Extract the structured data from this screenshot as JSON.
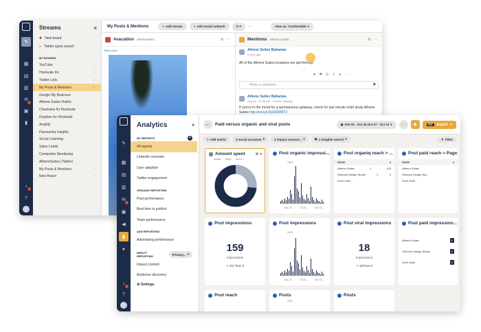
{
  "streams": {
    "title": "Streams",
    "quick": [
      "New board",
      "Twitter quick search"
    ],
    "section": "MY BOARDS",
    "boards": [
      "YouTube",
      "Hootsuite Inc",
      "Twitter Lists",
      "My Posts & Mentions",
      "Google My Business",
      "Athene Suites Hotels",
      "Cloudview for Hootsuite",
      "Dropbox for Hootsuite",
      "Amplify",
      "Panoramiq Insights",
      "Social Listening",
      "Sales Leads",
      "Competitor Monitoring",
      "AtheneSuites (Twitter)",
      "My Posts & Mentions",
      "New Board"
    ],
    "toolbar": {
      "title": "My Posts & Mentions",
      "add_stream": "Add stream",
      "add_network": "Add social network",
      "view": "View as: Comfortable"
    },
    "col1": {
      "title": "#vacation",
      "sub": "athenesuites"
    },
    "col1_img_note": "Read more",
    "col2": {
      "title": "Mentions",
      "sub": "Athene Suites"
    },
    "tweet1": {
      "name": "Athene Suites Bahamas",
      "meta": "6 mins ago",
      "text": "All of the Athene Suites locations are pet friendly!"
    },
    "comment_placeholder": "Write a comment...",
    "tweet2": {
      "name": "Athene Suites Bahamas",
      "meta": "Aug 26 · 10:35 AM · Custom Visibility",
      "text": "If you're in the mood for a spontaneous getaway, check for last minute hotel deals Athene Suites",
      "link": "http://ow.ly/r2b2S0RMT3"
    }
  },
  "analytics": {
    "title": "Analytics",
    "sec1": "MY REPORTS",
    "reports": [
      "All reports",
      "LinkedIn overview",
      "User adoption",
      "Twitter engagement"
    ],
    "sec2": "ORGANIC REPORTING",
    "organic": [
      "Post performance",
      "Best time to publish",
      "Team performance"
    ],
    "sec3": "ADS REPORTING",
    "ads": [
      "Advertising performance"
    ],
    "sec4": "IMPACT REPORTING",
    "primary": "Primary...",
    "impact": [
      "Impact content",
      "Audience discovery"
    ],
    "settings": "Settings",
    "report_title": "Paid versus organic and viral posts",
    "date_range": "Feb 01 - Oct 20  Oct 07 - Oct 13",
    "export": "Export",
    "filters": [
      "Add metric",
      "3 social accounts",
      "3 impact connect...",
      "1 insights search",
      "Filter"
    ],
    "cards": {
      "amount_spent": "Amount spent",
      "legend": [
        "SHARE",
        "VIDEO",
        "PHOTO"
      ],
      "organic_imp": "Post organic impressi...",
      "organic_reach": "Post organiq reach > ...",
      "paid_reach": "Post paid reach > Page",
      "post_imp_1": "Post impressions",
      "post_imp_2": "Post impressions",
      "viral": "Post viral impressions",
      "paid_imp": "Post paid impression...",
      "post_reach": "Post reach",
      "posts_1": "Posts",
      "posts_2": "Posts"
    },
    "page_col": "PAGE",
    "hash_col": "#",
    "reach_rows": [
      [
        "Athene Suites",
        "2",
        "118"
      ],
      [
        "Glorious Design Studio",
        "0",
        "0"
      ],
      [
        "Such Owls",
        "",
        ""
      ]
    ],
    "paid_rows": [
      "Athene Suites",
      "Glorious Design Sta...",
      "Such Owls"
    ],
    "paid_imp_rows": [
      [
        "Athene Suites",
        "0"
      ],
      [
        "Glorious Design Studio",
        "0"
      ],
      [
        "Such Owls",
        "0"
      ]
    ],
    "imp_value": "159",
    "imp_label": "Impressions",
    "imp_delta": "157 from 2",
    "viral_value": "18",
    "viral_label": "Impressions",
    "viral_delta": "18 from 0",
    "years": [
      "2022",
      "2023"
    ],
    "axis": [
      "Apr '21",
      "Jul '21",
      "Oct '21"
    ]
  }
}
